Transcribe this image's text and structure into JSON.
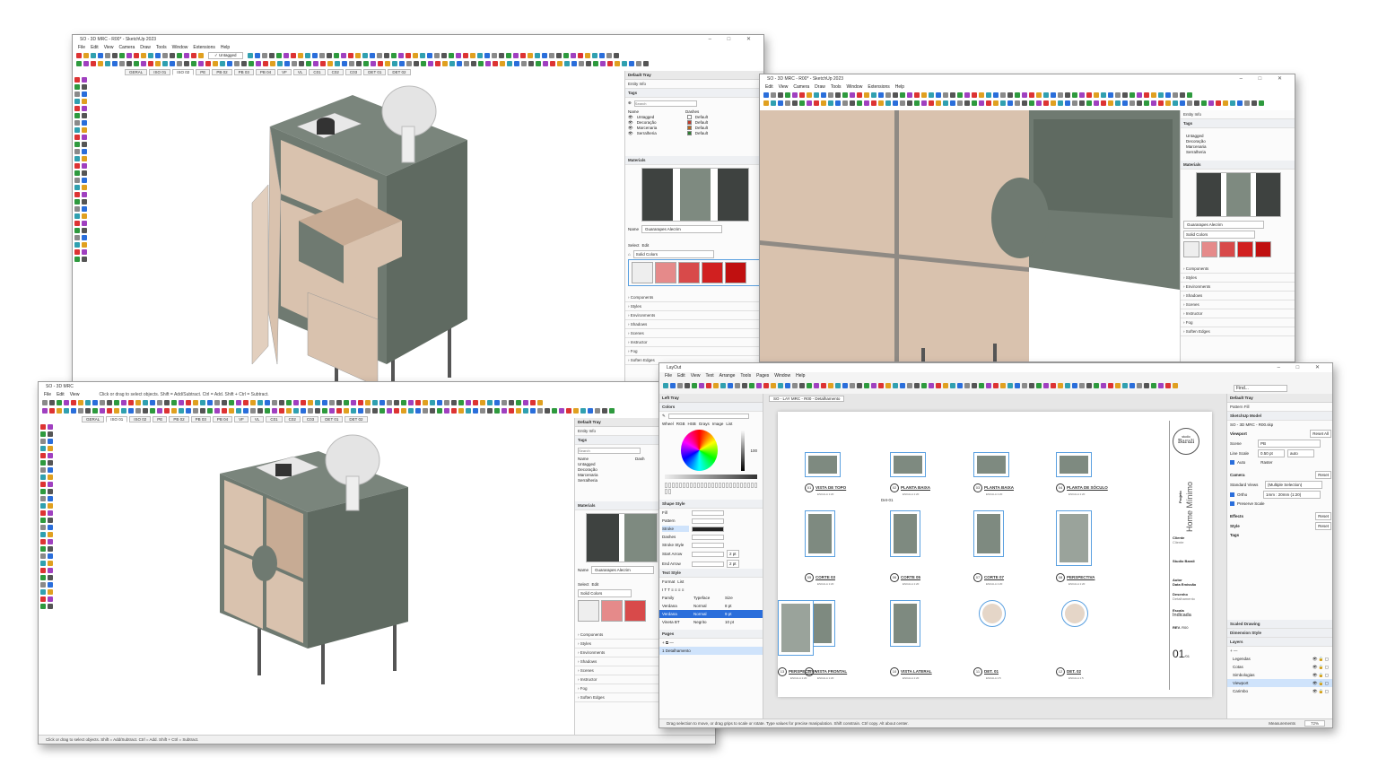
{
  "win1": {
    "title": "SO - 3D MRC - R00* - SketchUp 2023",
    "menus": [
      "File",
      "Edit",
      "View",
      "Camera",
      "Draw",
      "Tools",
      "Window",
      "Extensions",
      "Help"
    ],
    "tag_dropdown": "✓ Untagged",
    "scene_tabs": [
      "GERAL",
      "ISO 01",
      "ISO 02",
      "PE",
      "PB 02",
      "PB 03",
      "PB 04",
      "VF",
      "VL",
      "C01",
      "C02",
      "C03",
      "DET 01",
      "DET 02"
    ],
    "active_tab": "ISO 02",
    "tray": {
      "title": "Default Tray",
      "entity_info": "Entity Info",
      "tags": "Tags",
      "search_placeholder": "Search",
      "col_name": "Name",
      "col_dashes": "Dashes",
      "tag_rows": [
        {
          "name": "Untagged",
          "dash": "Default",
          "color": "#ffffff"
        },
        {
          "name": "Decoração",
          "dash": "Default",
          "color": "#c0392b"
        },
        {
          "name": "Marcenaria",
          "dash": "Default",
          "color": "#b5651d"
        },
        {
          "name": "Serralheria",
          "dash": "Default",
          "color": "#2e7d32"
        }
      ],
      "materials": "Materials",
      "material_name_label": "Name",
      "material_name": "Guararapes Alecrim",
      "select_label": "Select",
      "edit_label": "Edit",
      "library": "Solid Colors",
      "collapsed": [
        "Components",
        "Styles",
        "Environments",
        "Shadows",
        "Scenes",
        "Instructor",
        "Fog",
        "Soften Edges"
      ]
    }
  },
  "win2": {
    "title": "SO - 3D MRC - R00* - SketchUp 2023",
    "menus": [
      "Edit",
      "View",
      "Camera",
      "Draw",
      "Tools",
      "Window",
      "Extensions",
      "Help"
    ],
    "tray_sections": [
      "Entity Info",
      "Tags"
    ],
    "tag_names": [
      "Untagged",
      "Decoração",
      "Marcenaria",
      "Serralheria"
    ],
    "materials": "Materials",
    "material_name": "Guararapes Alecrim",
    "library": "Solid Colors",
    "collapsed": [
      "Components",
      "Styles",
      "Environments",
      "Shadows",
      "Scenes",
      "Instructor",
      "Fog",
      "Soften Edges"
    ]
  },
  "win3": {
    "title": "SO - 3D MRC",
    "menus": [
      "File",
      "Edit",
      "View"
    ],
    "hint": "Click or drag to select objects. Shift = Add/Subtract. Ctrl = Add. Shift + Ctrl = Subtract.",
    "scene_tabs": [
      "GERAL",
      "ISO 01",
      "ISO 02",
      "PE",
      "PB 02",
      "PB 03",
      "PB 04",
      "VF",
      "VL",
      "C01",
      "C02",
      "C03",
      "DET 01",
      "DET 02"
    ],
    "active_tab": "ISO 01",
    "tray": {
      "title": "Default Tray",
      "entity_info": "Entity Info",
      "tags": "Tags",
      "search_placeholder": "Search",
      "col_name": "Name",
      "col_dashes": "Dash",
      "tag_names": [
        "Untagged",
        "Decoração",
        "Marcenaria",
        "Serralheria"
      ],
      "materials": "Materials",
      "material_name_label": "Name",
      "material_name": "Guararapes Alecrim",
      "select_label": "Select",
      "edit_label": "Edit",
      "library": "Solid Colors",
      "collapsed": [
        "Components",
        "Styles",
        "Environments",
        "Shadows",
        "Scenes",
        "Instructor",
        "Fog",
        "Soften Edges"
      ]
    },
    "status": "Click or drag to select objects. Shift = Add/Subtract. Ctrl = Add. Shift + Ctrl = Subtract."
  },
  "layout": {
    "title": "LayOut",
    "menus": [
      "File",
      "Edit",
      "View",
      "Text",
      "Arrange",
      "Tools",
      "Pages",
      "Window",
      "Help"
    ],
    "left_tray": "Left Tray",
    "colors": "Colors",
    "color_tabs": [
      "Wheel",
      "RGB",
      "HSB",
      "Grays",
      "Image",
      "List"
    ],
    "opacity_value": "100",
    "shape_style": "Shape Style",
    "shape_rows": [
      "Fill",
      "Pattern",
      "Stroke",
      "Dashes",
      "Stroke Style",
      "Start Arrow",
      "End Arrow"
    ],
    "stroke_width": "2 pt",
    "text_style": "Text Style",
    "text_tabs": [
      "Format",
      "List"
    ],
    "text_cols": [
      "Family",
      "Typeface",
      "Size"
    ],
    "families": [
      "Verdana",
      "Verdana",
      "Vineta BT"
    ],
    "typefaces": [
      "Normal",
      "Normal",
      "Negrito"
    ],
    "sizes": [
      "8 pt",
      "9 pt",
      "10 pt"
    ],
    "pages": "Pages",
    "page_item": "1  Detalhamento",
    "doc_tab": "SO - LAY MRC - R00 - Detalhamento",
    "find": "Find...",
    "drawings": [
      {
        "num": "01",
        "title": "VISTA DE TOPO",
        "scale": "ESCALA 1:20"
      },
      {
        "num": "02",
        "title": "PLANTA BAIXA",
        "scale": "ESCALA 1:20"
      },
      {
        "num": "03",
        "title": "PLANTA BAIXA",
        "scale": "ESCALA 1:20"
      },
      {
        "num": "04",
        "title": "PLANTA DE SÓCULO",
        "scale": "ESCALA 1:20"
      },
      {
        "num": "05",
        "title": "CORTE 03",
        "scale": "ESCALA 1:20"
      },
      {
        "num": "06",
        "title": "CORTE 05",
        "scale": "ESCALA 1:20"
      },
      {
        "num": "07",
        "title": "CORTE 07",
        "scale": "ESCALA 1:20"
      },
      {
        "num": "08",
        "title": "PERSPECTIVA",
        "scale": "ESCALA 1:20"
      },
      {
        "num": "09",
        "title": "VISTA FRONTAL",
        "scale": "ESCALA 1:20"
      },
      {
        "num": "10",
        "title": "VISTA LATERAL",
        "scale": "ESCALA 1:20"
      },
      {
        "num": "11",
        "title": "DET. 01",
        "scale": "ESCALA 1:5"
      },
      {
        "num": "12",
        "title": "DET. 02",
        "scale": "ESCALA 1:5"
      },
      {
        "num": "13",
        "title": "PERSPECTIVA",
        "scale": "ESCALA 1:20"
      }
    ],
    "det_label": "Det-01",
    "titleblock": {
      "logo_top": "studio",
      "logo": "Barali",
      "projeto_label": "Projeto",
      "projeto": "Home Mínimo",
      "cliente_label": "Cliente",
      "cliente": "Cliente",
      "studio": "Studio Barali",
      "autor_label": "Autor",
      "data_label": "Data Emissão",
      "desenho_label": "Desenho",
      "desenho": "Detalhamento",
      "escala_label": "Escala",
      "escala": "Indicada",
      "rev_label": "REV.",
      "rev": "R00",
      "sheet": "01",
      "sheet_total": "/01"
    },
    "right_tray": {
      "title": "Default Tray",
      "pattern_fill": "Pattern Fill",
      "model": "SketchUp Model",
      "model_file": "SO - 3D MRC - R00.skp",
      "viewport": "Viewport",
      "reset_all": "Reset All",
      "scene_label": "Scene",
      "scene_value": "PB",
      "line_scale_label": "Line Scale",
      "line_scale": "0.50 pt",
      "line_auto": "auto",
      "auto_label": "Auto",
      "raster_label": "Raster",
      "camera": "Camera",
      "reset": "Reset",
      "standard_views_label": "Standard Views",
      "standard_views": "(Multiple Selection)",
      "ortho_label": "Ortho",
      "ortho_value": "1mm : 20mm (1:20)",
      "preserve_scale": "Preserve Scale",
      "effects": "Effects",
      "style": "Style",
      "tags": "Tags",
      "scaled_drawing": "Scaled Drawing",
      "dimension_style": "Dimension Style",
      "layers": "Layers",
      "layer_names": [
        "Legendas",
        "Cotas",
        "Simbologias",
        "Viewport",
        "Carimbo"
      ],
      "selected_layer": "Viewport"
    },
    "status": "Drag selection to move, or drag grips to scale or rotate. Type values for precise manipulation. Shift constrain. Ctrl copy. Alt about center.",
    "measurements_label": "Measurements",
    "zoom": "72%"
  },
  "colors": {
    "cabinet": "#6f7a71",
    "cabinet_dark": "#5a645c",
    "wood": "#d9c2ae",
    "wood_dark": "#c7ab94",
    "select_blue": "#cfe3fb",
    "accent_red": "#d33"
  }
}
